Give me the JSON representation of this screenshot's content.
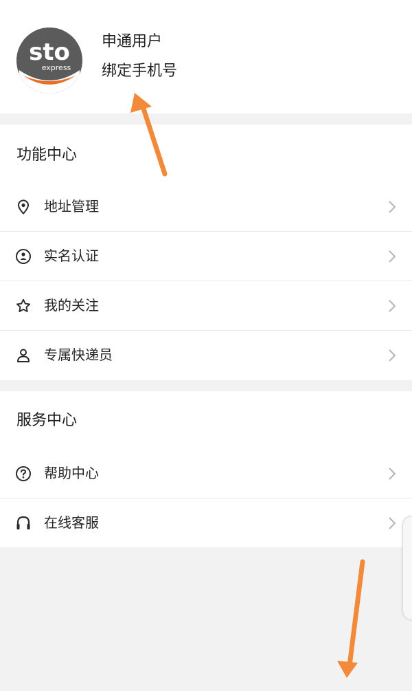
{
  "profile": {
    "logo_text": "sto",
    "logo_subtext": "express",
    "name": "申通用户",
    "bind_phone": "绑定手机号"
  },
  "sections": {
    "function_center": {
      "title": "功能中心",
      "items": [
        {
          "label": "地址管理",
          "icon": "location-pin-icon"
        },
        {
          "label": "实名认证",
          "icon": "id-verify-icon"
        },
        {
          "label": "我的关注",
          "icon": "star-icon"
        },
        {
          "label": "专属快递员",
          "icon": "person-icon"
        }
      ]
    },
    "service_center": {
      "title": "服务中心",
      "items": [
        {
          "label": "帮助中心",
          "icon": "question-icon"
        },
        {
          "label": "在线客服",
          "icon": "headset-icon"
        }
      ]
    }
  },
  "colors": {
    "accent_arrow": "#f28a3a",
    "logo_orange": "#e8702a",
    "logo_gray": "#5b5b5b",
    "background": "#f2f2f2"
  }
}
